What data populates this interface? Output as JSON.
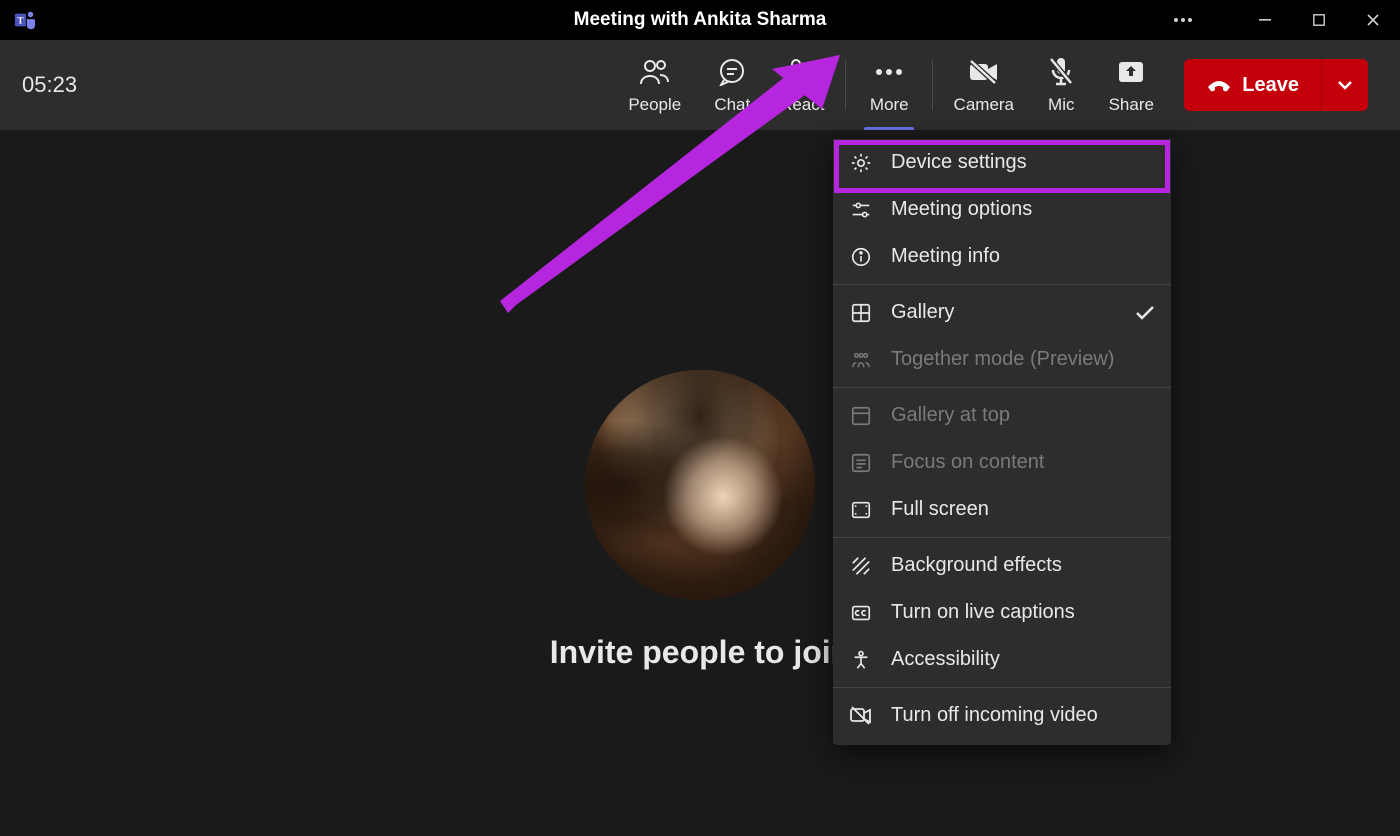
{
  "titlebar": {
    "title": "Meeting with Ankita Sharma"
  },
  "toolbar": {
    "timer": "05:23",
    "people": "People",
    "chat": "Chat",
    "react": "React",
    "more": "More",
    "camera": "Camera",
    "mic": "Mic",
    "share": "Share",
    "leave": "Leave"
  },
  "stage": {
    "invite": "Invite people to join"
  },
  "menu": {
    "device_settings": "Device settings",
    "meeting_options": "Meeting options",
    "meeting_info": "Meeting info",
    "gallery": "Gallery",
    "together_mode": "Together mode (Preview)",
    "gallery_at_top": "Gallery at top",
    "focus_content": "Focus on content",
    "full_screen": "Full screen",
    "background_effects": "Background effects",
    "live_captions": "Turn on live captions",
    "accessibility": "Accessibility",
    "incoming_video": "Turn off incoming video"
  },
  "annotation": {
    "highlight_color": "#b726df"
  }
}
